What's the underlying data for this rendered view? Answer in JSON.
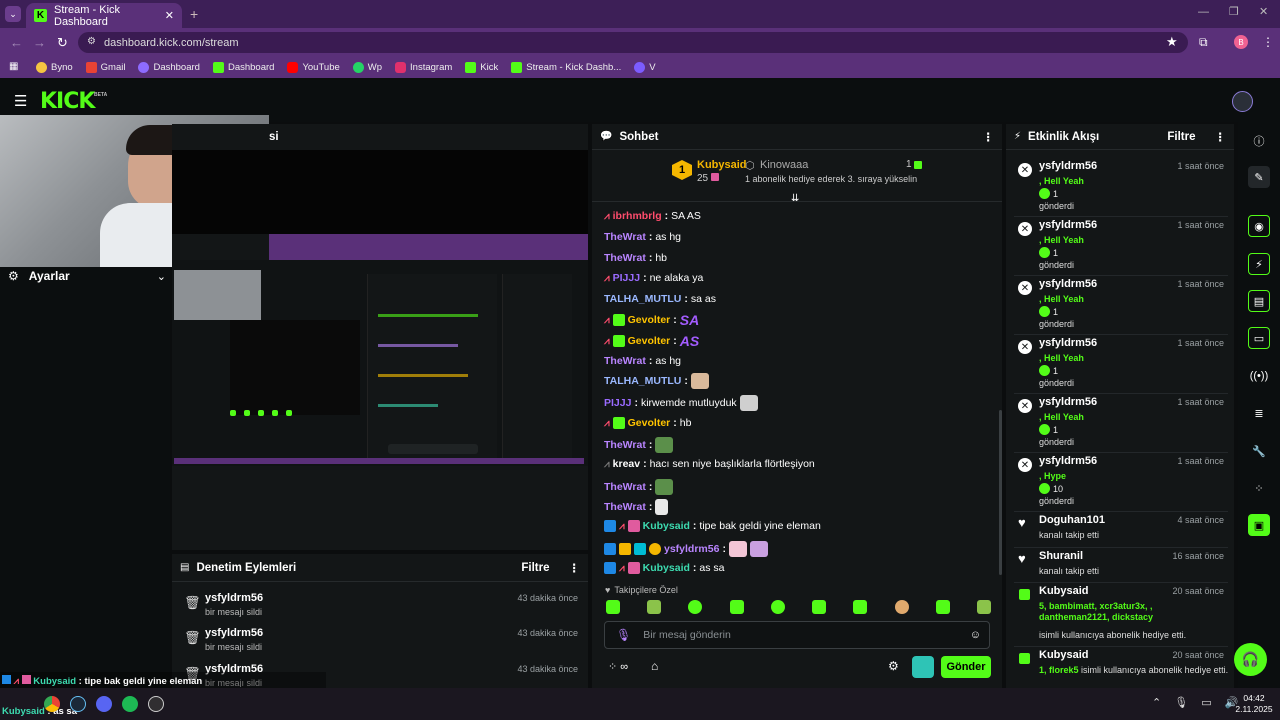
{
  "browser": {
    "tab_title": "Stream - Kick Dashboard",
    "url": "dashboard.kick.com/stream",
    "profile_letter": "B",
    "bookmarks": [
      "Byno",
      "Gmail",
      "Dashboard",
      "Dashboard",
      "YouTube",
      "Wp",
      "Instagram",
      "Kick",
      "Stream - Kick Dashb...",
      "V"
    ]
  },
  "header": {
    "logo": "KICK",
    "logo_tag": "BETA"
  },
  "settings": {
    "label": "Ayarlar"
  },
  "stream_panel": {
    "title_fragment": "si"
  },
  "moderation": {
    "title": "Denetim Eylemleri",
    "filter": "Filtre",
    "rows": [
      {
        "user": "ysfyldrm56",
        "action": "bir mesajı sildi",
        "time": "43 dakika önce"
      },
      {
        "user": "ysfyldrm56",
        "action": "bir mesajı sildi",
        "time": "43 dakika önce"
      },
      {
        "user": "ysfyldrm56",
        "action": "bir mesajı sildi",
        "time": "43 dakika önce"
      }
    ]
  },
  "chat": {
    "title": "Sohbet",
    "pinned": {
      "rank": "1",
      "user": "Kubysaid",
      "count": "25",
      "gift_user": "Kinowaaa",
      "gift_count": "1",
      "gift_text": "1 abonelik hediye ederek 3. sıraya yükselin"
    },
    "messages": [
      {
        "user": "ibrhmbrlg",
        "text": "SA AS",
        "color": "#ff4d6d"
      },
      {
        "user": "TheWrat",
        "text": "as hg",
        "color": "#b985ff"
      },
      {
        "user": "TheWrat",
        "text": "hb",
        "color": "#b985ff"
      },
      {
        "user": "PIJJJ",
        "text": "ne alaka ya",
        "color": "#9a6bff"
      },
      {
        "user": "TALHA_MUTLU",
        "text": "sa as",
        "color": "#9ab8ff"
      },
      {
        "user": "Gevolter",
        "text": "",
        "color": "#ffc400"
      },
      {
        "user": "Gevolter",
        "text": "",
        "color": "#ffc400"
      },
      {
        "user": "TheWrat",
        "text": "as hg",
        "color": "#b985ff"
      },
      {
        "user": "TALHA_MUTLU",
        "text": "",
        "color": "#9ab8ff"
      },
      {
        "user": "PIJJJ",
        "text": "kirwemde mutluyduk",
        "color": "#9a6bff"
      },
      {
        "user": "Gevolter",
        "text": "hb",
        "color": "#ffc400"
      },
      {
        "user": "TheWrat",
        "text": "",
        "color": "#b985ff"
      },
      {
        "user": "kreav",
        "text": "hacı sen niye başlıklarla flörtleşiyon",
        "color": "#ffffff"
      },
      {
        "user": "TheWrat",
        "text": "",
        "color": "#b985ff"
      },
      {
        "user": "TheWrat",
        "text": "",
        "color": "#b985ff"
      },
      {
        "user": "Kubysaid",
        "text": "tipe bak geldi yine eleman",
        "color": "#3ddbb0"
      },
      {
        "user": "ysfyldrm56",
        "text": "",
        "color": "#b985ff"
      },
      {
        "user": "Kubysaid",
        "text": "as sa",
        "color": "#3ddbb0"
      }
    ],
    "emote_sa": "SA",
    "emote_as": "AS",
    "followers_only": "Takipçilere Özel",
    "input_placeholder": "Bir mesaj gönderin",
    "send": "Gönder"
  },
  "activity": {
    "title": "Etkinlik Akışı",
    "filter": "Filtre",
    "events": [
      {
        "user": "ysfyldrm56",
        "time": "1 saat önce",
        "line1": ", Hell Yeah",
        "amount": "1",
        "line2": "gönderdi"
      },
      {
        "user": "ysfyldrm56",
        "time": "1 saat önce",
        "line1": ", Hell Yeah",
        "amount": "1",
        "line2": "gönderdi"
      },
      {
        "user": "ysfyldrm56",
        "time": "1 saat önce",
        "line1": ", Hell Yeah",
        "amount": "1",
        "line2": "gönderdi"
      },
      {
        "user": "ysfyldrm56",
        "time": "1 saat önce",
        "line1": ", Hell Yeah",
        "amount": "1",
        "line2": "gönderdi"
      },
      {
        "user": "ysfyldrm56",
        "time": "1 saat önce",
        "line1": ", Hell Yeah",
        "amount": "1",
        "line2": "gönderdi"
      },
      {
        "user": "ysfyldrm56",
        "time": "1 saat önce",
        "line1": ", Hype",
        "amount": "10",
        "line2": "gönderdi"
      }
    ],
    "follows": [
      {
        "user": "Doguhan101",
        "time": "4 saat önce",
        "text": "kanalı takip etti"
      },
      {
        "user": "Shuranil",
        "time": "16 saat önce",
        "text": "kanalı takip etti"
      }
    ],
    "gifts": [
      {
        "user": "Kubysaid",
        "time": "20 saat önce",
        "recipients": "5, bambimatt, xcr3atur3x, , dantheman2121, dickstacy",
        "text": "isimli kullanıcıya abonelik hediye etti."
      },
      {
        "user": "Kubysaid",
        "time": "20 saat önce",
        "recipients": "1, florek5",
        "text": "isimli kullanıcıya abonelik hediye etti."
      }
    ]
  },
  "overlay_chat": [
    {
      "user": "Kubysaid",
      "text": " : tipe bak geldi yine eleman"
    },
    {
      "user": "ysfyldrm56",
      "text": ""
    },
    {
      "user": "Kubysaid",
      "text": " : as sa"
    }
  ],
  "taskbar": {
    "time": "04:42",
    "date": "2.11.2025"
  },
  "colors": {
    "accent": "#53fc18",
    "browser": "#5a3079",
    "panel": "#131617"
  }
}
